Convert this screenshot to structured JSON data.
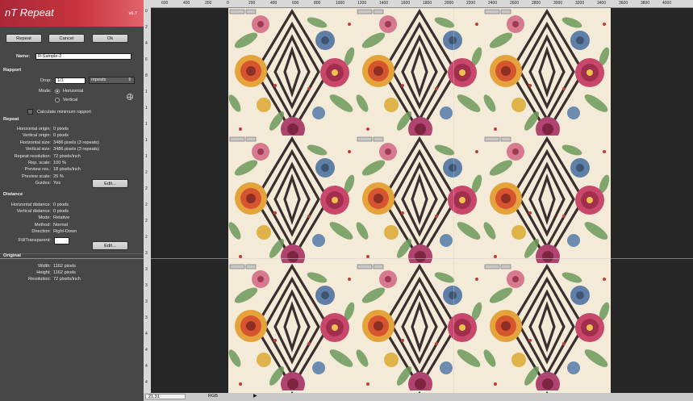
{
  "plugin": {
    "title": "nT Repeat",
    "version": "v6.7"
  },
  "buttons": {
    "repeat": "Repeat",
    "cancel": "Cancel",
    "ok": "Ok",
    "edit_repeat": "Edit...",
    "edit_distance": "Edit..."
  },
  "name": {
    "label": "Name:",
    "value": "R-Sample-2"
  },
  "rapport": {
    "heading": "Rapport",
    "drop_label": "Drop:",
    "drop_value": "1/1",
    "drop_unit": "repeats",
    "mode_label": "Mode:",
    "mode_horizontal": "Horizontal",
    "mode_vertical": "Vertical",
    "calc_min": "Calculate minimum rapport"
  },
  "repeat": {
    "heading": "Repeat",
    "rows": [
      {
        "label": "Horizontal origin:",
        "value": "0 pixels"
      },
      {
        "label": "Vertical origin:",
        "value": "0 pixels"
      },
      {
        "label": "Horizontal size:",
        "value": "3486 pixels (3 repeats)"
      },
      {
        "label": "Vertical size:",
        "value": "3486 pixels (3 repeats)"
      },
      {
        "label": "Repeat resolution:",
        "value": "72 pixels/inch"
      },
      {
        "label": "Rep. scale:",
        "value": "100 %"
      },
      {
        "label": "Preview res.:",
        "value": "18 pixels/inch"
      },
      {
        "label": "Preview scale:",
        "value": "25 %"
      },
      {
        "label": "Guides:",
        "value": "Yes"
      }
    ]
  },
  "distance": {
    "heading": "Distance",
    "rows": [
      {
        "label": "Horizontal distance:",
        "value": "0 pixels"
      },
      {
        "label": "Vertical distance:",
        "value": "0 pixels"
      },
      {
        "label": "Mode:",
        "value": "Relative"
      },
      {
        "label": "Method:",
        "value": "Normal"
      },
      {
        "label": "Direction:",
        "value": "Right-Down"
      }
    ],
    "fill_label": "Fill/Transparent:"
  },
  "original": {
    "heading": "Original",
    "rows": [
      {
        "label": "Width:",
        "value": "1162 pixels"
      },
      {
        "label": "Height:",
        "value": "1162 pixels"
      },
      {
        "label": "Resolution:",
        "value": "72 pixels/inch"
      }
    ]
  },
  "ruler": {
    "top_ticks": [
      "600",
      "400",
      "200",
      "0",
      "200",
      "400",
      "600",
      "800",
      "1000",
      "1200",
      "1400",
      "1600",
      "1800",
      "2000",
      "2200",
      "2400",
      "2600",
      "2800",
      "3000",
      "3200",
      "3400",
      "3600",
      "3800",
      "4000"
    ],
    "left_ticks": [
      "0",
      "2",
      "4",
      "6",
      "8",
      "1",
      "1",
      "1",
      "1",
      "1",
      "2",
      "2",
      "2",
      "2",
      "2",
      "3",
      "3",
      "3",
      "3",
      "3",
      "4",
      "4",
      "4",
      "4"
    ]
  },
  "status": {
    "zoom": "21.31",
    "mode": "RGB"
  },
  "colors": {
    "accent": "#c8343f",
    "panel": "#474747",
    "canvas": "#262626"
  }
}
